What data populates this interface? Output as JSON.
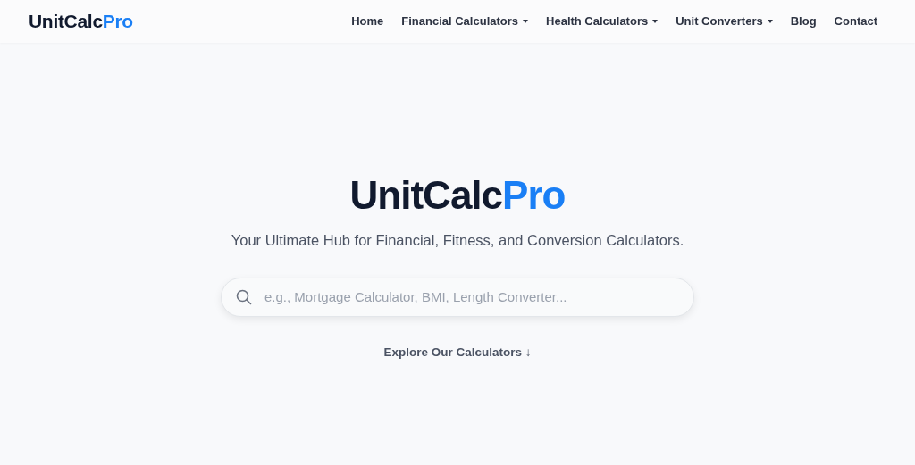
{
  "navbar": {
    "brand": {
      "main": "UnitCalc",
      "accent": "Pro"
    },
    "items": [
      {
        "label": "Home",
        "has_menu": false
      },
      {
        "label": "Financial Calculators",
        "has_menu": true
      },
      {
        "label": "Health Calculators",
        "has_menu": true
      },
      {
        "label": "Unit Converters",
        "has_menu": true
      },
      {
        "label": "Blog",
        "has_menu": false
      },
      {
        "label": "Contact",
        "has_menu": false
      }
    ]
  },
  "hero": {
    "title": {
      "main": "UnitCalc",
      "accent": "Pro"
    },
    "subtitle": "Your Ultimate Hub for Financial, Fitness, and Conversion Calculators.",
    "search": {
      "placeholder": "e.g., Mortgage Calculator, BMI, Length Converter..."
    },
    "explore_link": "Explore Our Calculators ↓"
  }
}
